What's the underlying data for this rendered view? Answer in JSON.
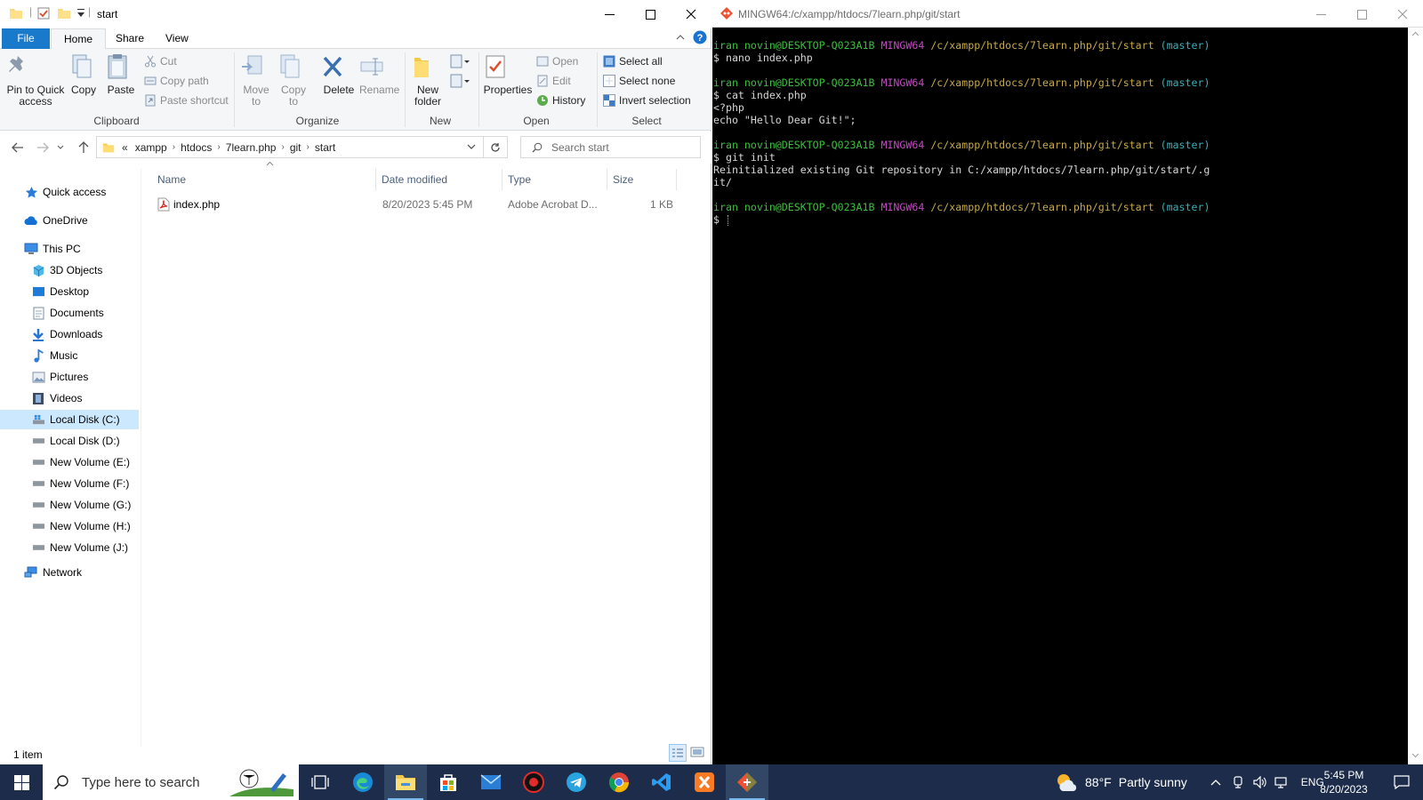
{
  "explorer": {
    "title": "start",
    "tabs": {
      "file": "File",
      "home": "Home",
      "share": "Share",
      "view": "View"
    },
    "ribbon": {
      "clipboard": {
        "label": "Clipboard",
        "pin": "Pin to Quick access",
        "copy": "Copy",
        "paste": "Paste",
        "cut": "Cut",
        "copy_path": "Copy path",
        "paste_shortcut": "Paste shortcut"
      },
      "organize": {
        "label": "Organize",
        "move_to": "Move to",
        "copy_to": "Copy to",
        "delete": "Delete",
        "rename": "Rename"
      },
      "new": {
        "label": "New",
        "new_folder": "New folder"
      },
      "open": {
        "label": "Open",
        "properties": "Properties",
        "open": "Open",
        "edit": "Edit",
        "history": "History"
      },
      "select": {
        "label": "Select",
        "select_all": "Select all",
        "select_none": "Select none",
        "invert": "Invert selection"
      }
    },
    "address": {
      "overflow": "«",
      "crumbs": [
        "xampp",
        "htdocs",
        "7learn.php",
        "git",
        "start"
      ]
    },
    "search": {
      "placeholder": "Search start"
    },
    "nav": {
      "quick_access": "Quick access",
      "onedrive": "OneDrive",
      "this_pc": "This PC",
      "objects3d": "3D Objects",
      "desktop": "Desktop",
      "documents": "Documents",
      "downloads": "Downloads",
      "music": "Music",
      "pictures": "Pictures",
      "videos": "Videos",
      "disk_c": "Local Disk (C:)",
      "disk_d": "Local Disk (D:)",
      "vol_e": "New Volume (E:)",
      "vol_f": "New Volume (F:)",
      "vol_g": "New Volume (G:)",
      "vol_h": "New Volume (H:)",
      "vol_j": "New Volume (J:)",
      "network": "Network"
    },
    "columns": {
      "name": "Name",
      "date": "Date modified",
      "type": "Type",
      "size": "Size"
    },
    "files": [
      {
        "name": "index.php",
        "date": "8/20/2023 5:45 PM",
        "type": "Adobe Acrobat D...",
        "size": "1 KB"
      }
    ],
    "status": "1 item"
  },
  "terminal": {
    "title": "MINGW64:/c/xampp/htdocs/7learn.php/git/start",
    "prompt": {
      "user": "iran novin@DESKTOP-Q023A1B",
      "env": "MINGW64",
      "path": "/c/xampp/htdocs/7learn.php/git/start",
      "branch": "(master)",
      "symbol": "$"
    },
    "cmd1": "nano index.php",
    "cmd2": "cat index.php",
    "out2a": "<?php",
    "out2b": "echo \"Hello Dear Git!\";",
    "cmd3": "git init",
    "out3a": "Reinitialized existing Git repository in C:/xampp/htdocs/7learn.php/git/start/.g",
    "out3b": "it/"
  },
  "taskbar": {
    "search_placeholder": "Type here to search",
    "weather_temp": "88°F",
    "weather_text": "Partly sunny",
    "lang": "ENG",
    "time": "5:45 PM",
    "date": "8/20/2023"
  }
}
